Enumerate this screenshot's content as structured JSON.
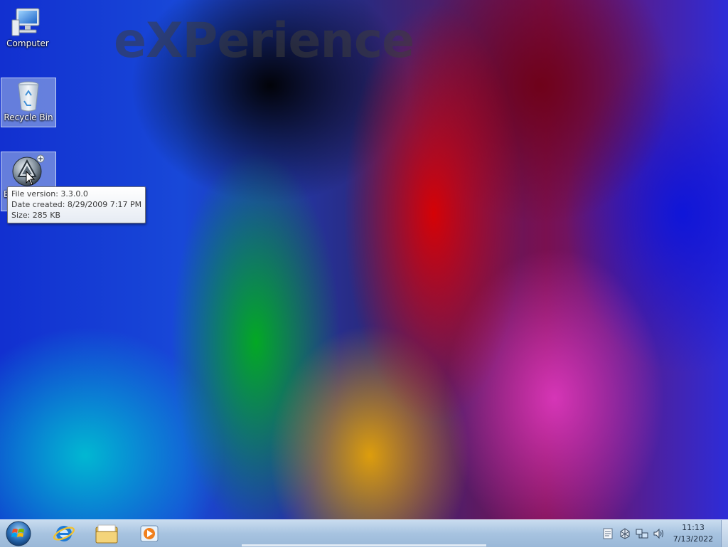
{
  "desktop": {
    "watermark": "eXPerience",
    "icons": [
      {
        "label": "Computer"
      },
      {
        "label": "Recycle Bin"
      },
      {
        "label": "E"
      }
    ]
  },
  "tooltip": {
    "line1": "File version: 3.3.0.0",
    "line2": "Date created: 8/29/2009 7:17 PM",
    "line3": "Size: 285 KB"
  },
  "taskbar": {
    "pinned": [
      "internet-explorer-icon",
      "windows-explorer-icon",
      "media-player-icon"
    ],
    "tray": [
      "action-center-icon",
      "network-share-icon",
      "network-icon",
      "volume-icon"
    ],
    "clock": {
      "time": "11:13",
      "date": "7/13/2022"
    }
  }
}
